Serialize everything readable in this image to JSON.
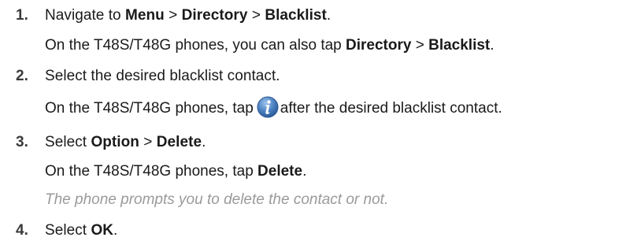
{
  "steps": [
    {
      "number": "1.",
      "text": [
        "Navigate to ",
        "Menu",
        " > ",
        "Directory",
        " > ",
        "Blacklist",
        "."
      ],
      "sub": [
        "On the T48S/T48G phones, you can also tap ",
        "Directory",
        " > ",
        "Blacklist",
        "."
      ]
    },
    {
      "number": "2.",
      "text": "Select the desired blacklist contact.",
      "sub_before": "On the T48S/T48G phones, tap",
      "sub_icon": "info-icon",
      "sub_after": "after the desired blacklist contact."
    },
    {
      "number": "3.",
      "text": [
        "Select ",
        "Option",
        " > ",
        "Delete",
        "."
      ],
      "sub": [
        "On the T48S/T48G phones, tap ",
        "Delete",
        "."
      ],
      "note": "The phone prompts you to delete the contact or not."
    },
    {
      "number": "4.",
      "text": [
        "Select ",
        "OK",
        "."
      ]
    }
  ],
  "colors": {
    "text": "#1a1a1a",
    "note": "#9a9a9a",
    "icon_blue": "#4a7fc0"
  }
}
